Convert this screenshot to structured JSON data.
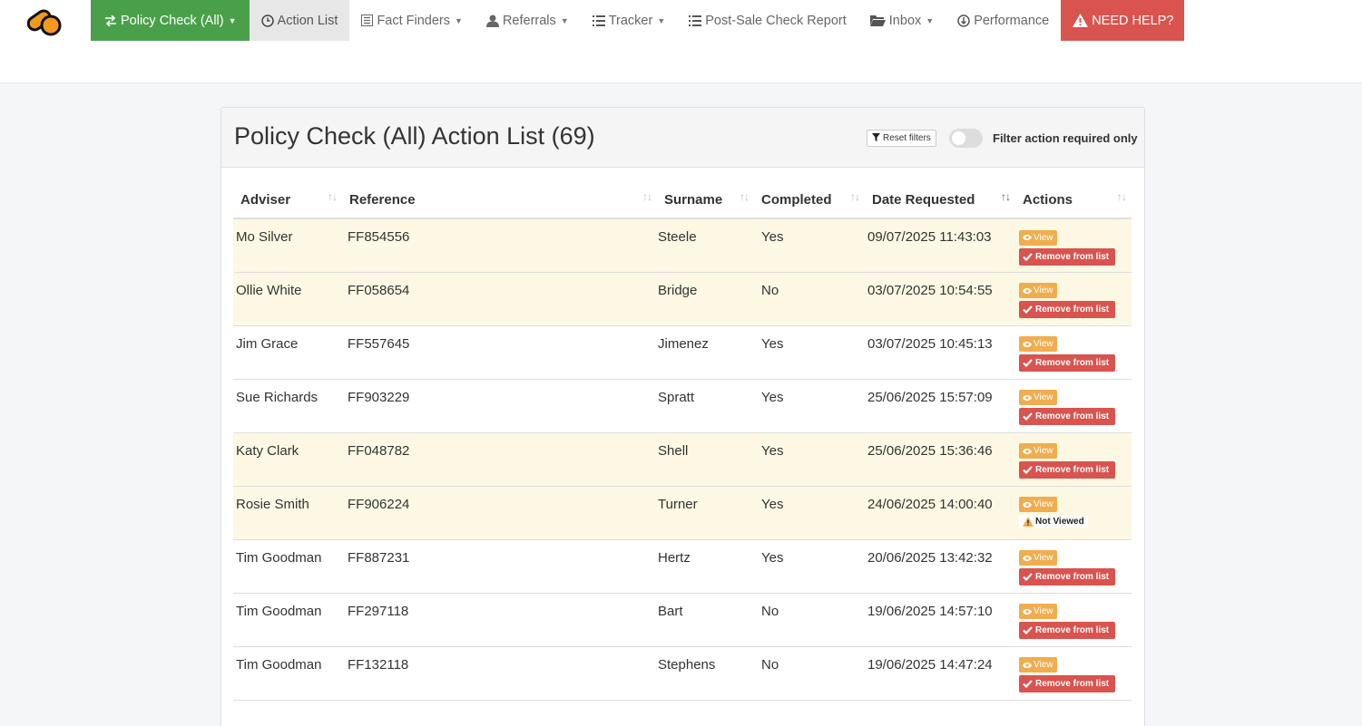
{
  "nav": {
    "items": [
      {
        "key": "policy",
        "label": "Policy Check (All)",
        "icon": "swap-arrows-icon",
        "dropdown": true,
        "style": "green"
      },
      {
        "key": "action",
        "label": "Action List",
        "icon": "clock-icon",
        "dropdown": false,
        "style": "grey"
      },
      {
        "key": "fact",
        "label": "Fact Finders",
        "icon": "document-list-icon",
        "dropdown": true,
        "style": ""
      },
      {
        "key": "referrals",
        "label": "Referrals",
        "icon": "user-icon",
        "dropdown": true,
        "style": ""
      },
      {
        "key": "tracker",
        "label": "Tracker",
        "icon": "list-icon",
        "dropdown": true,
        "style": ""
      },
      {
        "key": "postsale",
        "label": "Post-Sale Check Report",
        "icon": "list-icon",
        "dropdown": false,
        "style": ""
      },
      {
        "key": "inbox",
        "label": "Inbox",
        "icon": "folder-icon",
        "dropdown": true,
        "style": ""
      },
      {
        "key": "performance",
        "label": "Performance",
        "icon": "circle-arrow-icon",
        "dropdown": false,
        "style": ""
      }
    ],
    "help_label": "NEED HELP?"
  },
  "panel": {
    "title": "Policy Check (All) Action List (69)",
    "reset_label": "Reset filters",
    "toggle_label": "Filter action required only"
  },
  "table": {
    "headers": [
      "Adviser",
      "Reference",
      "Surname",
      "Completed",
      "Date Requested",
      "Actions"
    ],
    "rows": [
      {
        "adviser": "Mo Silver",
        "reference": "FF854556",
        "surname": "Steele",
        "completed": "Yes",
        "date": "09/07/2025 11:43:03",
        "highlight": true,
        "status": "remove"
      },
      {
        "adviser": "Ollie White",
        "reference": "FF058654",
        "surname": "Bridge",
        "completed": "No",
        "date": "03/07/2025 10:54:55",
        "highlight": true,
        "status": "remove"
      },
      {
        "adviser": "Jim Grace",
        "reference": "FF557645",
        "surname": "Jimenez",
        "completed": "Yes",
        "date": "03/07/2025 10:45:13",
        "highlight": false,
        "status": "remove"
      },
      {
        "adviser": "Sue Richards",
        "reference": "FF903229",
        "surname": "Spratt",
        "completed": "Yes",
        "date": "25/06/2025 15:57:09",
        "highlight": false,
        "status": "remove"
      },
      {
        "adviser": "Katy Clark",
        "reference": "FF048782",
        "surname": "Shell",
        "completed": "Yes",
        "date": "25/06/2025 15:36:46",
        "highlight": true,
        "status": "remove"
      },
      {
        "adviser": "Rosie Smith",
        "reference": "FF906224",
        "surname": "Turner",
        "completed": "Yes",
        "date": "24/06/2025 14:00:40",
        "highlight": true,
        "status": "not_viewed"
      },
      {
        "adviser": "Tim Goodman",
        "reference": "FF887231",
        "surname": "Hertz",
        "completed": "Yes",
        "date": "20/06/2025 13:42:32",
        "highlight": false,
        "status": "remove"
      },
      {
        "adviser": "Tim Goodman",
        "reference": "FF297118",
        "surname": "Bart",
        "completed": "No",
        "date": "19/06/2025 14:57:10",
        "highlight": false,
        "status": "remove"
      },
      {
        "adviser": "Tim Goodman",
        "reference": "FF132118",
        "surname": "Stephens",
        "completed": "No",
        "date": "19/06/2025 14:47:24",
        "highlight": false,
        "status": "remove"
      }
    ],
    "view_label": "View",
    "remove_label": "Remove from list",
    "not_viewed_label": "Not Viewed",
    "sorted_column": "Date Requested"
  },
  "colors": {
    "brand_orange": "#f29a1f",
    "nav_green": "#4aa04a",
    "danger": "#d9534f",
    "warning": "#f0ad4e",
    "row_highlight": "#fcf8e3"
  }
}
